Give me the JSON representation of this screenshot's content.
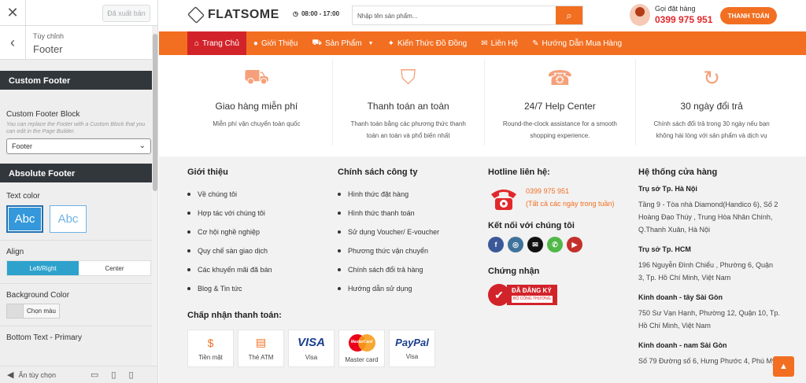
{
  "customizer": {
    "published_label": "Đã xuất bản",
    "breadcrumb": "Tùy chỉnh",
    "section_title": "Footer",
    "custom_footer_group": "Custom Footer",
    "custom_footer_block_label": "Custom Footer Block",
    "custom_footer_block_desc": "You can replace the Footer with a Custom Block that you can edit in the Page Builder.",
    "custom_footer_block_value": "Footer",
    "absolute_footer_group": "Absolute Footer",
    "text_color_label": "Text color",
    "text_color_options": [
      "Abc",
      "Abc"
    ],
    "align_label": "Align",
    "align_options": [
      "Left/Right",
      "Center"
    ],
    "bg_color_label": "Background Color",
    "bg_color_button": "Chọn màu",
    "bottom_text_label": "Bottom Text - Primary",
    "hide_controls_label": "Ẩn tùy chọn"
  },
  "site": {
    "brand": "FLATSOME",
    "hours": "08:00 - 17:00",
    "search_placeholder": "Nhập tên sản phẩm...",
    "call_label": "Gọi đặt hàng",
    "call_number": "0399 975 951",
    "checkout_label": "THANH TOÁN",
    "nav": [
      "Trang Chủ",
      "Giới Thiệu",
      "Sản Phẩm",
      "Kiến Thức Đồ Đồng",
      "Liên Hệ",
      "Hướng Dẫn Mua Hàng"
    ],
    "features": [
      {
        "title": "Giao hàng miễn phí",
        "desc": "Miễn phí vận chuyển toàn quốc"
      },
      {
        "title": "Thanh toán an toàn",
        "desc": "Thanh toán bằng các phương thức thanh toán an toàn và phổ biến nhất"
      },
      {
        "title": "24/7 Help Center",
        "desc": "Round-the-clock assistance for a smooth shopping experience."
      },
      {
        "title": "30 ngày đổi trả",
        "desc": "Chính sách đổi trả trong 30 ngày nếu bạn không hài lòng với sản phẩm và dịch vụ"
      }
    ],
    "footer": {
      "about_title": "Giới thiệu",
      "about_links": [
        "Về chúng tôi",
        "Hợp tác với chúng tôi",
        "Cơ hội nghề nghiệp",
        "Quy chế sàn giao dịch",
        "Các khuyến mãi đã bán",
        "Blog & Tin tức"
      ],
      "policy_title": "Chính sách công ty",
      "policy_links": [
        "Hình thức đặt hàng",
        "Hình thức thanh toán",
        "Sử dụng Voucher/ E-voucher",
        "Phương thức vận chuyển",
        "Chính sách đổi trả hàng",
        "Hướng dẫn sử dụng"
      ],
      "hotline_title": "Hotline liên hệ:",
      "hotline_number": "0399 975 951",
      "hotline_note": "(Tất cả các ngày trong tuần)",
      "social_title": "Kết nối với chúng tôi",
      "cert_title": "Chứng nhận",
      "cert_badge": "ĐÃ ĐĂNG KÝ",
      "cert_sub": "BỘ CÔNG THƯƠNG",
      "payment_title": "Chấp nhận thanh toán:",
      "payments": [
        "Tiền mặt",
        "Thẻ ATM",
        "Visa",
        "Master card",
        "Visa"
      ],
      "visa_logo": "VISA",
      "mastercard_logo": "MasterCard",
      "paypal_logo": "PayPal",
      "stores_title": "Hệ thống cửa hàng",
      "stores": [
        {
          "name": "Trụ sở Tp. Hà Nội",
          "addr": "Tầng 9 - Tòa nhà Diamond(Handico 6), Số 2 Hoàng Đạo Thúy , Trung Hòa Nhân Chính, Q.Thanh Xuân, Hà Nội"
        },
        {
          "name": "Trụ sở Tp. HCM",
          "addr": "196 Nguyễn Đình Chiểu , Phường 6, Quận 3, Tp. Hồ Chí Minh, Việt Nam"
        },
        {
          "name": "Kinh doanh - tây Sài Gòn",
          "addr": "750 Sư Vạn Hạnh, Phường 12, Quận 10, Tp. Hồ Chí Minh, Việt Nam"
        },
        {
          "name": "Kinh doanh - nam Sài Gòn",
          "addr": "Số 79 Đường số 6, Hưng Phước 4, Phú Mỹ"
        }
      ]
    }
  },
  "colors": {
    "accent": "#f26f21",
    "nav_active": "#d2232a",
    "customizer_blue": "#3498db"
  },
  "icons": [
    "close-icon",
    "back-icon",
    "clock-icon",
    "search-icon",
    "truck-icon",
    "shield-lock-icon",
    "support-24-icon",
    "return-30-icon",
    "phone-icon",
    "facebook-icon",
    "instagram-icon",
    "email-icon",
    "whatsapp-icon",
    "youtube-icon",
    "chevron-up-icon"
  ]
}
